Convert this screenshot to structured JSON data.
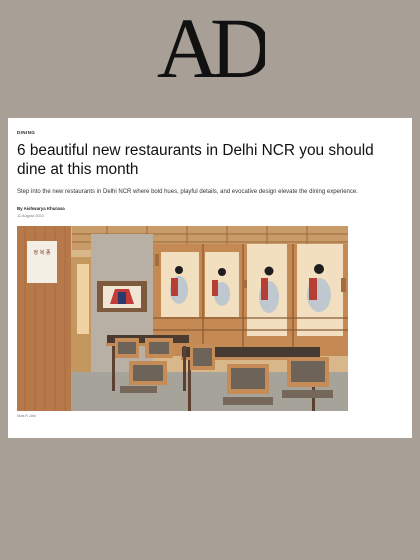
{
  "brand": {
    "logo_text": "AD"
  },
  "article": {
    "category": "DINING",
    "headline": "6 beautiful new restaurants in Delhi NCR you should dine at this month",
    "dek": "Step into the new restaurants in Delhi NCR where bold hues, playful details, and evocative design elevate the dining experience.",
    "byline": "By Aishwarya Khurana",
    "date": "11 August 2023",
    "image_credit": "Nuts R Just"
  },
  "hero_image": {
    "sign_text": "정 복 종"
  },
  "colors": {
    "page_background": "#a89f96",
    "card_background": "#ffffff",
    "headline": "#111111"
  }
}
